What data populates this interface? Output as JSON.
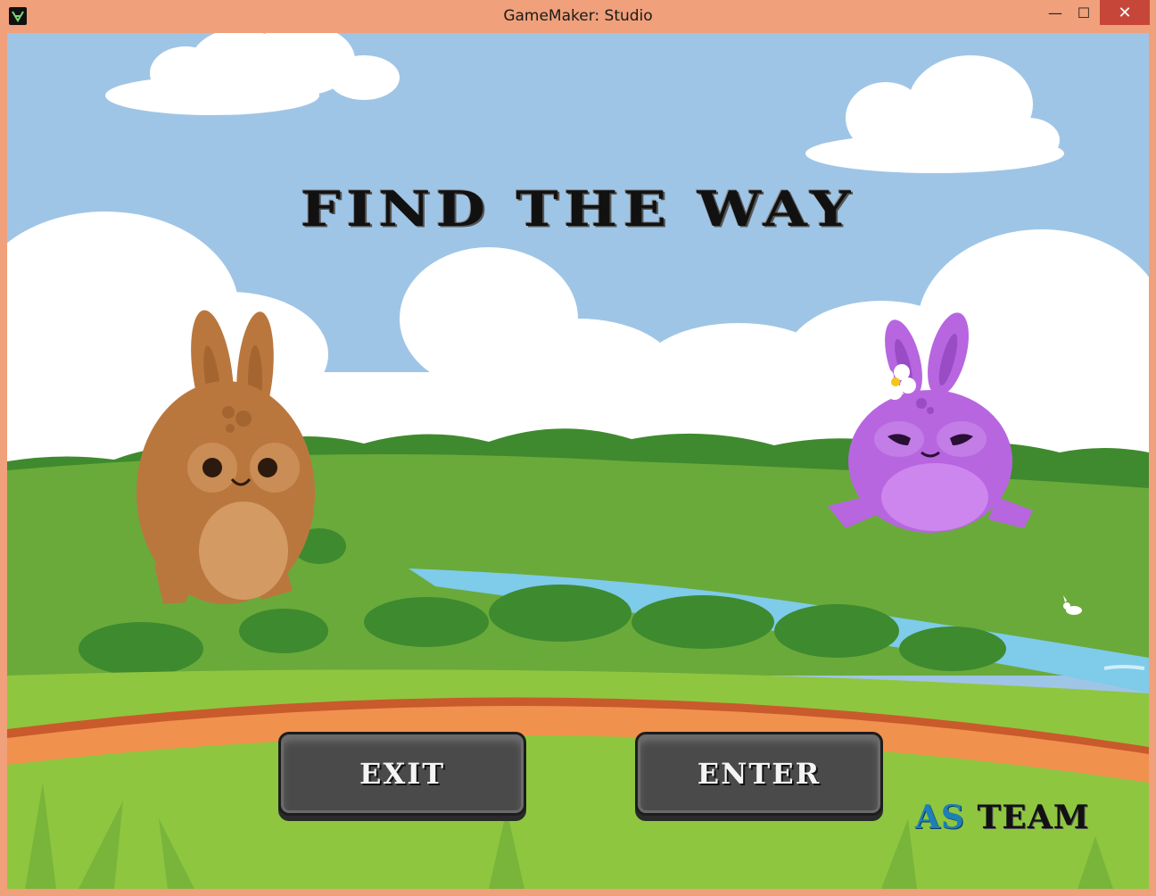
{
  "window": {
    "title": "GameMaker: Studio",
    "controls": {
      "minimize": "—",
      "maximize": "☐",
      "close": "✕"
    }
  },
  "game": {
    "title": "FIND THE WAY",
    "buttons": {
      "exit": "EXIT",
      "enter": "ENTER"
    },
    "team": {
      "prefix": "AS",
      "suffix": "TEAM"
    }
  },
  "colors": {
    "sky": "#a0c6e6",
    "grass": "#8fc63f",
    "dark_grass": "#5aa132",
    "river": "#7ecbea",
    "path_orange": "#f0914e",
    "brown_bunny": "#b9773e",
    "purple_bunny": "#b766e0",
    "title_bar": "#f0a07a"
  }
}
